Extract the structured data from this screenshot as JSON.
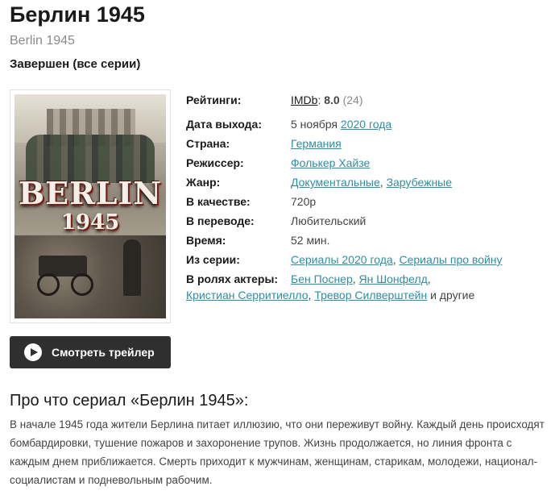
{
  "title": "Берлин 1945",
  "original_title": "Berlin 1945",
  "status": "Завершен (все серии)",
  "poster": {
    "title_text": "BERLIN",
    "year_text": "1945"
  },
  "info": {
    "ratings_label": "Рейтинги:",
    "imdb_label": "IMDb",
    "imdb_sep": ":",
    "imdb_score": "8.0",
    "imdb_votes": "(24)",
    "release_label": "Дата выхода:",
    "release_day": "5 ноября",
    "release_year": "2020 года",
    "country_label": "Страна:",
    "country": "Германия",
    "director_label": "Режиссер:",
    "director": "Фолькер Хайзе",
    "genre_label": "Жанр:",
    "genres": [
      "Документальные",
      "Зарубежные"
    ],
    "quality_label": "В качестве:",
    "quality": "720p",
    "translation_label": "В переводе:",
    "translation": "Любительский",
    "duration_label": "Время:",
    "duration": "52 мин.",
    "series_label": "Из серии:",
    "series": [
      "Сериалы 2020 года",
      "Сериалы про войну"
    ],
    "actors_label": "В ролях актеры:",
    "actors": [
      "Бен Поснер",
      "Ян Шонфелд",
      "Кристиан Серритиелло",
      "Тревор Силверштейн"
    ],
    "actors_more": "и другие"
  },
  "trailer_button": "Смотреть трейлер",
  "about": {
    "heading": "Про что сериал «Берлин 1945»:",
    "text": "В начале 1945 года жители Берлина питает иллюзию, что они переживут войну. Каждый день происходят бомбардировки, тушение пожаров и захоронение трупов. Жизнь продолжается, но линия фронта с каждым днем приближается. Смерть приходит к мужчинам, женщинам, старикам, молодежи, национал-социалистам и подневольным рабочим."
  }
}
